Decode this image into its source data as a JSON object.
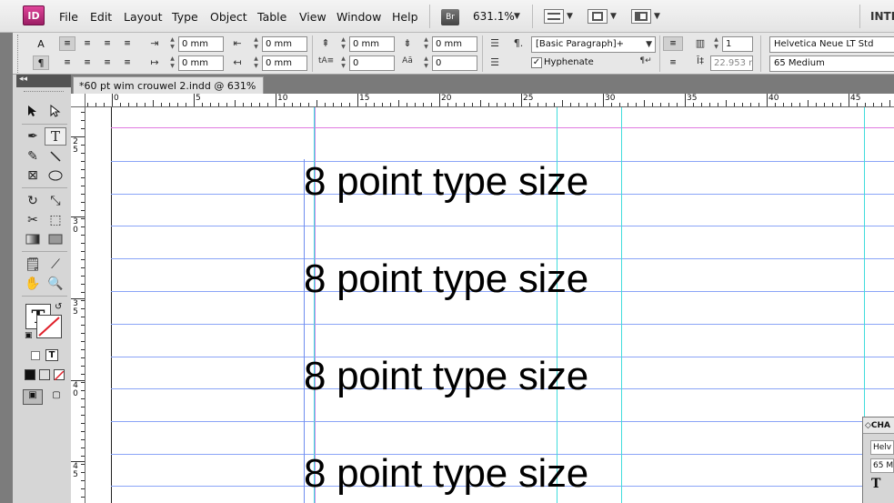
{
  "app": {
    "logo": "ID",
    "workspace_label": "INTE"
  },
  "menu": [
    "File",
    "Edit",
    "Layout",
    "Type",
    "Object",
    "Table",
    "View",
    "Window",
    "Help"
  ],
  "bridge_label": "Br",
  "zoom": "631.1%",
  "control": {
    "char_mode": "A",
    "para_mode": "¶",
    "left_indent": "0 mm",
    "right_indent": "0 mm",
    "first_line_indent": "0 mm",
    "last_line_indent": "0 mm",
    "space_before": "0 mm",
    "space_after": "0 mm",
    "drop_cap_lines": "0",
    "drop_cap_chars": "0",
    "paragraph_style": "[Basic Paragraph]+",
    "hyphenate_label": "Hyphenate",
    "hyphenate_checked": true,
    "columns": "1",
    "baseline_value": "22.953 mı",
    "font_family": "Helvetica Neue LT Std",
    "font_style": "65 Medium"
  },
  "tools_header": "◂◂",
  "document": {
    "tab_title": "*60 pt wim crouwel 2.indd @ 631%",
    "close_glyph": "×"
  },
  "ruler_h_labels": [
    "0",
    "5",
    "10",
    "15",
    "20",
    "25",
    "30",
    "35",
    "40",
    "45"
  ],
  "ruler_v_labels": [
    "2\n5",
    "3\n0",
    "3\n5",
    "4\n0",
    "4\n5",
    "1\n4\n0"
  ],
  "sample_text": [
    "8 point type size",
    "8 point type size",
    "8 point type size",
    "8 point type size"
  ],
  "char_panel": {
    "title": "CHA",
    "font": "Helv",
    "style": "65 M",
    "icon": "T"
  },
  "colors": {
    "accent": "#c42a85",
    "baseline_grid": "#8aa4f7",
    "guide": "#40dcdc",
    "margin": "#c88ae6"
  }
}
